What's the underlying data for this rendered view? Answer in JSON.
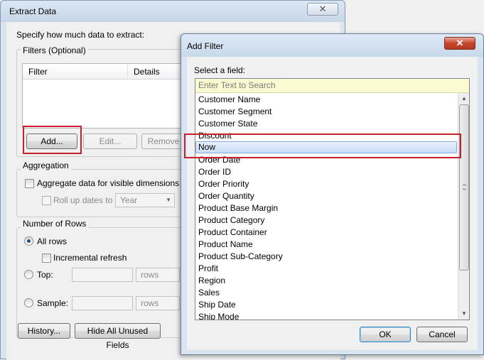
{
  "extract": {
    "title": "Extract Data",
    "close": "✕",
    "prompt": "Specify how much data to extract:",
    "filters": {
      "label": "Filters (Optional)",
      "columns": [
        "Filter",
        "Details"
      ],
      "add": "Add...",
      "edit": "Edit...",
      "remove": "Remove"
    },
    "aggregation": {
      "label": "Aggregation",
      "aggregate": "Aggregate data for visible dimensions",
      "rollup": "Roll up dates to",
      "rollup_value": "Year"
    },
    "rows": {
      "label": "Number of Rows",
      "all": "All rows",
      "incremental": "Incremental refresh",
      "top": "Top:",
      "top_unit": "rows",
      "sample": "Sample:",
      "sample_unit": "rows"
    },
    "history": "History...",
    "hide_unused": "Hide All Unused Fields"
  },
  "filter_dialog": {
    "title": "Add Filter",
    "close": "✕",
    "prompt": "Select a field:",
    "search_placeholder": "Enter Text to Search",
    "fields": [
      "Customer Name",
      "Customer Segment",
      "Customer State",
      "Discount",
      "Now",
      "Order Date",
      "Order ID",
      "Order Priority",
      "Order Quantity",
      "Product Base Margin",
      "Product Category",
      "Product Container",
      "Product Name",
      "Product Sub-Category",
      "Profit",
      "Region",
      "Sales",
      "Ship Date",
      "Ship Mode"
    ],
    "selected": "Now",
    "ok": "OK",
    "cancel": "Cancel"
  }
}
